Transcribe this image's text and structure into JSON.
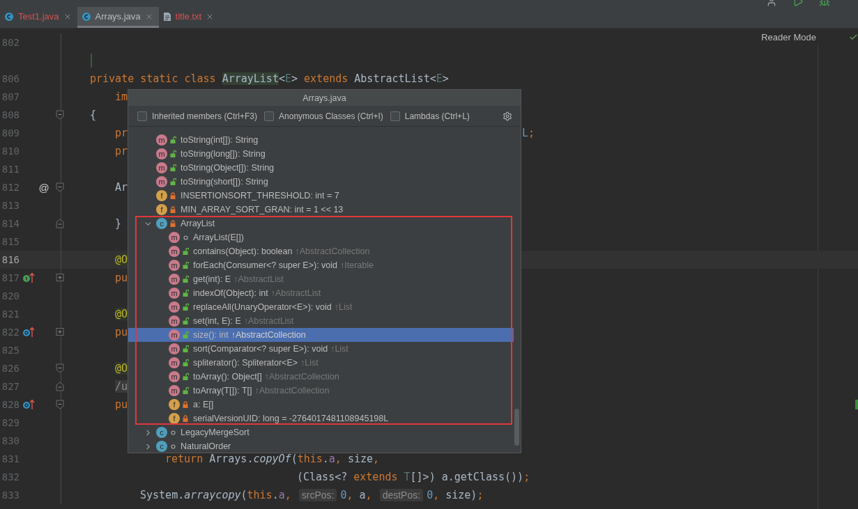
{
  "tabs": [
    {
      "label": "Test1.java",
      "kind": "class",
      "selected": false,
      "color": "#d25252"
    },
    {
      "label": "Arrays.java",
      "kind": "class",
      "selected": true,
      "color": "#bbbbbb"
    },
    {
      "label": "title.txt",
      "kind": "text",
      "selected": false,
      "color": "#d25252"
    }
  ],
  "reader_mode": "Reader Mode",
  "code_lines": [
    {
      "number": "802"
    },
    {
      "caret": true
    },
    {
      "number": "806",
      "tokens": [
        {
          "text": "private static class ",
          "kind": "keyword"
        },
        {
          "text": "ArrayList",
          "kind": "usage"
        },
        {
          "text": "<",
          "kind": "plain"
        },
        {
          "text": "E",
          "kind": "typeparam"
        },
        {
          "text": "> ",
          "kind": "plain"
        },
        {
          "text": "extends ",
          "kind": "keyword"
        },
        {
          "text": "AbstractList<",
          "kind": "plain"
        },
        {
          "text": "E",
          "kind": "typeparam"
        },
        {
          "text": ">",
          "kind": "plain"
        }
      ]
    },
    {
      "number": "807",
      "indent": {
        "kind": "member"
      },
      "tokens": [
        {
          "text": "im",
          "kind": "keyword"
        }
      ]
    },
    {
      "number": "808",
      "fold": {
        "kind": "start"
      },
      "tokens": [
        {
          "text": "{",
          "kind": "plain"
        }
      ]
    },
    {
      "number": "809",
      "indent": {
        "kind": "member"
      },
      "tokens": [
        {
          "text": "pr",
          "kind": "keyword"
        }
      ],
      "tokens_right": [
        {
          "text": "L",
          "kind": "number"
        },
        {
          "text": ";",
          "kind": "keyword"
        }
      ]
    },
    {
      "number": "810",
      "indent": {
        "kind": "member"
      },
      "tokens": [
        {
          "text": "pr",
          "kind": "keyword"
        }
      ]
    },
    {
      "number": "811"
    },
    {
      "number": "812",
      "mark": "@",
      "fold": {
        "kind": "start"
      },
      "indent": {
        "kind": "member"
      },
      "tokens": [
        {
          "text": "Ar",
          "kind": "plain"
        }
      ]
    },
    {
      "number": "813"
    },
    {
      "number": "814",
      "fold": {
        "kind": "end"
      },
      "indent": {
        "kind": "member"
      },
      "tokens": [
        {
          "text": "}",
          "kind": "plain"
        }
      ]
    },
    {
      "number": "815"
    },
    {
      "number": "816",
      "current": true,
      "indent": {
        "kind": "member"
      },
      "tokens": [
        {
          "text": "@O",
          "kind": "annotation"
        }
      ]
    },
    {
      "number": "817",
      "gutter_icon": {
        "kind": "implements"
      },
      "fold": {
        "kind": "collapsed"
      },
      "indent": {
        "kind": "member"
      },
      "tokens": [
        {
          "text": "pu",
          "kind": "keyword"
        }
      ]
    },
    {
      "number": "820"
    },
    {
      "number": "821",
      "indent": {
        "kind": "member"
      },
      "tokens": [
        {
          "text": "@O",
          "kind": "annotation"
        }
      ]
    },
    {
      "number": "822",
      "gutter_icon": {
        "kind": "overrides"
      },
      "fold": {
        "kind": "collapsed"
      },
      "indent": {
        "kind": "member"
      },
      "tokens": [
        {
          "text": "pu",
          "kind": "keyword"
        }
      ]
    },
    {
      "number": "825"
    },
    {
      "number": "826",
      "fold": {
        "kind": "start"
      },
      "indent": {
        "kind": "member"
      },
      "tokens": [
        {
          "text": "@O",
          "kind": "annotation"
        }
      ]
    },
    {
      "number": "827",
      "fold": {
        "kind": "end"
      },
      "indent": {
        "kind": "member"
      },
      "tokens": [
        {
          "text": "/u",
          "kind": "doc"
        }
      ]
    },
    {
      "number": "828",
      "gutter_icon": {
        "kind": "overrides"
      },
      "fold": {
        "kind": "start"
      },
      "indent": {
        "kind": "member"
      },
      "tokens": [
        {
          "text": "pu",
          "kind": "keyword"
        }
      ]
    },
    {
      "number": "829"
    },
    {
      "number": "830"
    },
    {
      "number": "831",
      "indent": {
        "kind": "nested"
      },
      "tokens": [
        {
          "text": "return ",
          "kind": "keyword"
        },
        {
          "text": "Arrays.",
          "kind": "plain"
        },
        {
          "text": "copyOf",
          "kind": "static"
        },
        {
          "text": "(",
          "kind": "plain"
        },
        {
          "text": "this",
          "kind": "keyword"
        },
        {
          "text": ".",
          "kind": "plain"
        },
        {
          "text": "a",
          "kind": "field"
        },
        {
          "text": ", ",
          "kind": "keyword"
        },
        {
          "text": "size",
          "kind": "plain"
        },
        {
          "text": ",",
          "kind": "keyword"
        }
      ]
    },
    {
      "number": "832",
      "indent": {
        "kind": "continuation"
      },
      "tokens": [
        {
          "text": "(Class<? ",
          "kind": "plain"
        },
        {
          "text": "extends ",
          "kind": "keyword"
        },
        {
          "text": "T",
          "kind": "typeparam"
        },
        {
          "text": "[]>) a.getClass())",
          "kind": "plain"
        },
        {
          "text": ";",
          "kind": "keyword"
        }
      ]
    },
    {
      "number": "833",
      "indent": {
        "kind": "body"
      },
      "tokens": [
        {
          "text": "System.",
          "kind": "plain"
        },
        {
          "text": "arraycopy",
          "kind": "static"
        },
        {
          "text": "(",
          "kind": "plain"
        },
        {
          "text": "this",
          "kind": "keyword"
        },
        {
          "text": ".",
          "kind": "plain"
        },
        {
          "text": "a",
          "kind": "field"
        },
        {
          "text": ", ",
          "kind": "keyword"
        },
        {
          "text": "srcPos:",
          "kind": "hint"
        },
        {
          "text": "0",
          "kind": "number"
        },
        {
          "text": ", ",
          "kind": "keyword"
        },
        {
          "text": "a",
          "kind": "plain"
        },
        {
          "text": ", ",
          "kind": "keyword"
        },
        {
          "text": "destPos:",
          "kind": "hint"
        },
        {
          "text": "0",
          "kind": "number"
        },
        {
          "text": ", ",
          "kind": "keyword"
        },
        {
          "text": "size)",
          "kind": "plain"
        },
        {
          "text": ";",
          "kind": "keyword"
        }
      ]
    }
  ],
  "popup": {
    "title": "Arrays.java",
    "filters": [
      {
        "label": "Inherited members (Ctrl+F3)",
        "checked": false
      },
      {
        "label": "Anonymous Classes (Ctrl+I)",
        "checked": false
      },
      {
        "label": "Lambdas (Ctrl+L)",
        "checked": false
      }
    ],
    "items": [
      {
        "kind": "method",
        "icon": "m",
        "access": {
          "kind": "public"
        },
        "text": "toString(int[]): String",
        "selected": false
      },
      {
        "kind": "method",
        "icon": "m",
        "access": {
          "kind": "public"
        },
        "text": "toString(long[]): String",
        "selected": false
      },
      {
        "kind": "method",
        "icon": "m",
        "access": {
          "kind": "public"
        },
        "text": "toString(Object[]): String",
        "selected": false
      },
      {
        "kind": "method",
        "icon": "m",
        "access": {
          "kind": "public"
        },
        "text": "toString(short[]): String",
        "selected": false
      },
      {
        "kind": "field",
        "icon": "f",
        "access": {
          "kind": "private"
        },
        "text": "INSERTIONSORT_THRESHOLD: int = 7",
        "selected": false
      },
      {
        "kind": "field",
        "icon": "f",
        "access": {
          "kind": "private"
        },
        "text": "MIN_ARRAY_SORT_GRAN: int = 1 << 13",
        "selected": false
      },
      {
        "kind": "class",
        "icon": "c",
        "access": {
          "kind": "private"
        },
        "text": "ArrayList",
        "expanded": true,
        "outlined": true,
        "selected": false,
        "children": [
          {
            "kind": "method",
            "icon": "m",
            "access": {
              "kind": "package"
            },
            "text": "ArrayList(E[])",
            "selected": false
          },
          {
            "kind": "method",
            "icon": "m",
            "access": {
              "kind": "public"
            },
            "text": "contains(Object): boolean",
            "origin": "↑AbstractCollection",
            "selected": false
          },
          {
            "kind": "method",
            "icon": "m",
            "access": {
              "kind": "public"
            },
            "text": "forEach(Consumer<? super E>): void",
            "origin": "↑Iterable",
            "selected": false
          },
          {
            "kind": "method",
            "icon": "m",
            "access": {
              "kind": "public"
            },
            "text": "get(int): E",
            "origin": "↑AbstractList",
            "selected": false
          },
          {
            "kind": "method",
            "icon": "m",
            "access": {
              "kind": "public"
            },
            "text": "indexOf(Object): int",
            "origin": "↑AbstractList",
            "selected": false
          },
          {
            "kind": "method",
            "icon": "m",
            "access": {
              "kind": "public"
            },
            "text": "replaceAll(UnaryOperator<E>): void",
            "origin": "↑List",
            "selected": false
          },
          {
            "kind": "method",
            "icon": "m",
            "access": {
              "kind": "public"
            },
            "text": "set(int, E): E",
            "origin": "↑AbstractList",
            "selected": false
          },
          {
            "kind": "method",
            "icon": "m",
            "access": {
              "kind": "public"
            },
            "text": "size(): int",
            "origin": "↑AbstractCollection",
            "selected": true
          },
          {
            "kind": "method",
            "icon": "m",
            "access": {
              "kind": "public"
            },
            "text": "sort(Comparator<? super E>): void",
            "origin": "↑List",
            "selected": false
          },
          {
            "kind": "method",
            "icon": "m",
            "access": {
              "kind": "public"
            },
            "text": "spliterator(): Spliterator<E>",
            "origin": "↑List",
            "selected": false
          },
          {
            "kind": "method",
            "icon": "m",
            "access": {
              "kind": "public"
            },
            "text": "toArray(): Object[]",
            "origin": "↑AbstractCollection",
            "selected": false
          },
          {
            "kind": "method",
            "icon": "m",
            "access": {
              "kind": "public"
            },
            "text": "toArray(T[]): T[]",
            "origin": "↑AbstractCollection",
            "selected": false
          },
          {
            "kind": "field",
            "icon": "f",
            "access": {
              "kind": "private"
            },
            "text": "a: E[]",
            "selected": false
          },
          {
            "kind": "field",
            "icon": "f",
            "access": {
              "kind": "private"
            },
            "text": "serialVersionUID: long = -2764017481108945198L",
            "selected": false
          }
        ]
      },
      {
        "kind": "class",
        "icon": "c",
        "access": {
          "kind": "package"
        },
        "text": "LegacyMergeSort",
        "expanded": false,
        "selected": false
      },
      {
        "kind": "class",
        "icon": "c",
        "access": {
          "kind": "package"
        },
        "text": "NaturalOrder",
        "expanded": false,
        "selected": false
      }
    ]
  }
}
